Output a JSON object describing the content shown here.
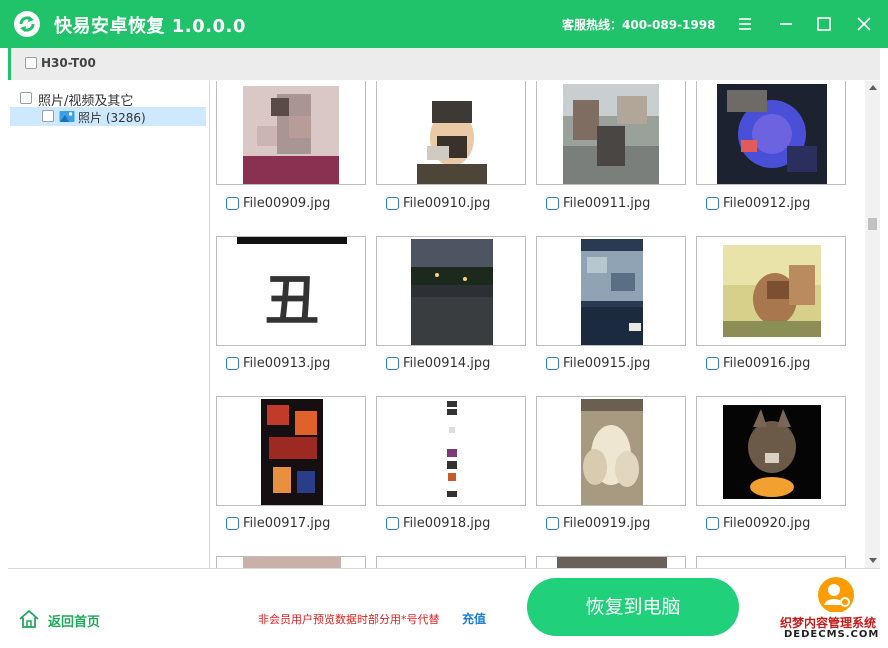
{
  "app": {
    "title": "快易安卓恢复 1.0.0.0",
    "hotline": "客服热线：400-089-1998"
  },
  "device": {
    "name": "H30-T00"
  },
  "tree": {
    "root_label": "照片/视频及其它",
    "child_label": "照片 (3286)"
  },
  "files": [
    "File00909.jpg",
    "File00910.jpg",
    "File00911.jpg",
    "File00912.jpg",
    "File00913.jpg",
    "File00914.jpg",
    "File00915.jpg",
    "File00916.jpg",
    "File00917.jpg",
    "File00918.jpg",
    "File00919.jpg",
    "File00920.jpg"
  ],
  "thumb_text": {
    "chou": "丑"
  },
  "footer": {
    "home_label": "返回首页",
    "member_note": "非会员用户预览数据时部分用*号代替",
    "recharge_label": "充值",
    "recover_label": "恢复到电脑"
  },
  "watermark": {
    "line1": "织梦内容管理系统",
    "line2": "DEDECMS.COM"
  },
  "colors": {
    "brand_green": "#21c36a",
    "button_green": "#21d07a",
    "selection_blue": "#cde8ff",
    "warning_red": "#e02020",
    "link_blue": "#1e7fd0",
    "avatar_orange": "#ff9d00"
  }
}
